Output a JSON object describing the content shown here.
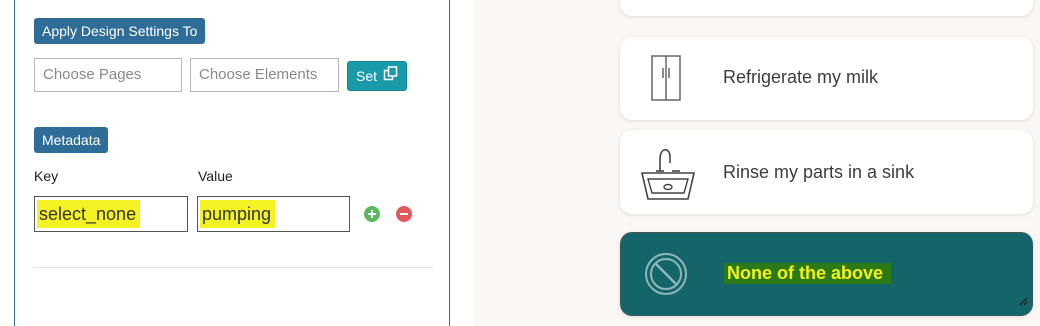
{
  "design_settings": {
    "heading": "Apply Design Settings To",
    "pages_placeholder": "Choose Pages",
    "elements_placeholder": "Choose Elements",
    "set_label": "Set"
  },
  "metadata": {
    "heading": "Metadata",
    "key_label": "Key",
    "value_label": "Value",
    "key_value": "select_none",
    "value_value": "pumping",
    "add_icon": "plus-circle-icon",
    "remove_icon": "minus-circle-icon"
  },
  "options": [
    {
      "label": "Refrigerate my milk",
      "icon": "refrigerator-icon"
    },
    {
      "label": "Rinse my parts in a sink",
      "icon": "sink-icon"
    },
    {
      "label": "None of the above",
      "icon": "no-symbol-icon",
      "selected": true
    }
  ],
  "colors": {
    "section_label_bg": "#2e6d98",
    "set_button_bg": "#1a9aa8",
    "highlight": "#f5f224",
    "selected_card_bg": "#14656a",
    "add_icon": "#5cb85c",
    "remove_icon": "#e05a5a"
  }
}
